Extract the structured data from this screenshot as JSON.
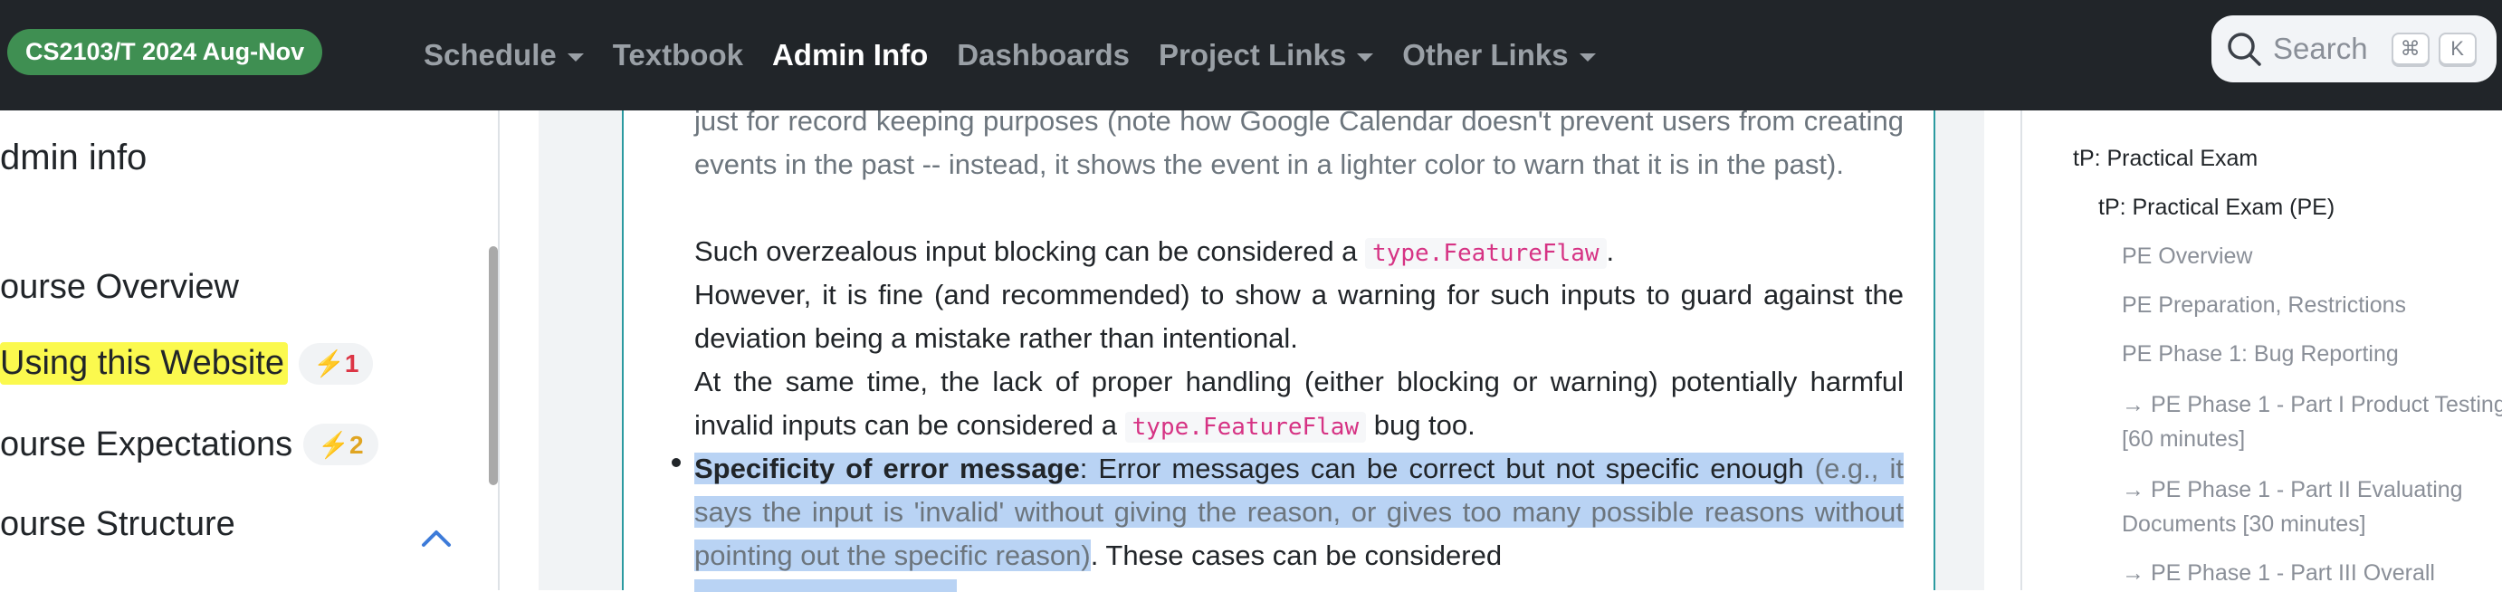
{
  "navbar": {
    "brand": "CS2103/T 2024 Aug-Nov",
    "items": [
      {
        "label": "Schedule",
        "dropdown": true
      },
      {
        "label": "Textbook",
        "dropdown": false
      },
      {
        "label": "Admin Info",
        "dropdown": false,
        "active": true
      },
      {
        "label": "Dashboards",
        "dropdown": false
      },
      {
        "label": "Project Links",
        "dropdown": true
      },
      {
        "label": "Other Links",
        "dropdown": true
      }
    ],
    "search": {
      "placeholder": "Search",
      "shortcut_keys": [
        "⌘",
        "K"
      ]
    }
  },
  "sidebar": {
    "title": "dmin info",
    "items": [
      {
        "label": "ourse Overview"
      },
      {
        "label": "Using this Website",
        "highlighted": true,
        "badge": "⚡1"
      },
      {
        "label": "ourse Expectations",
        "badge": "⚡2"
      },
      {
        "label": "ourse Structure",
        "expanded": true
      }
    ]
  },
  "content": {
    "p1": "just for record keeping purposes (note how Google Calendar doesn't prevent users from creating events in the past -- instead, it shows the event in a lighter color to warn that it is in the past).",
    "p2_before": "Such overzealous input blocking can be considered a ",
    "p2_code": "type.FeatureFlaw",
    "p2_after": ".",
    "p3": "However, it is fine (and recommended) to show a warning for such inputs to guard against the deviation being a mistake rather than intentional.",
    "p4_before": "At the same time, the lack of proper handling (either blocking or warning) potentially harmful invalid inputs can be considered a ",
    "p4_code": "type.FeatureFlaw",
    "p4_after": " bug too.",
    "b1_bold": "Specificity of error message",
    "b1_text": ": Error messages can be correct but not specific enough ",
    "b1_gray": "(e.g., it says the input is 'invalid' without giving the reason, or gives too many possible reasons without pointing out the specific reason)",
    "b1_end": ". These cases can be considered"
  },
  "toc": {
    "items": [
      {
        "label": "tP: Practical Exam",
        "level": 0
      },
      {
        "label": "tP: Practical Exam (PE)",
        "level": 1
      },
      {
        "label": "PE Overview",
        "level": 2
      },
      {
        "label": "PE Preparation, Restrictions",
        "level": 2
      },
      {
        "label": "PE Phase 1: Bug Reporting",
        "level": 2
      },
      {
        "label": "→ PE Phase 1 - Part I Product Testing [60 minutes]",
        "level": 2
      },
      {
        "label": "→ PE Phase 1 - Part II Evaluating Documents [30 minutes]",
        "level": 2
      },
      {
        "label": "→ PE Phase 1 - Part III Overall",
        "level": 2
      }
    ]
  },
  "colors": {
    "brand": "#3f8f52",
    "navbar": "#212529",
    "selection": "#b9d3f4",
    "highlight": "#fbf94e",
    "code": "#d63384"
  }
}
